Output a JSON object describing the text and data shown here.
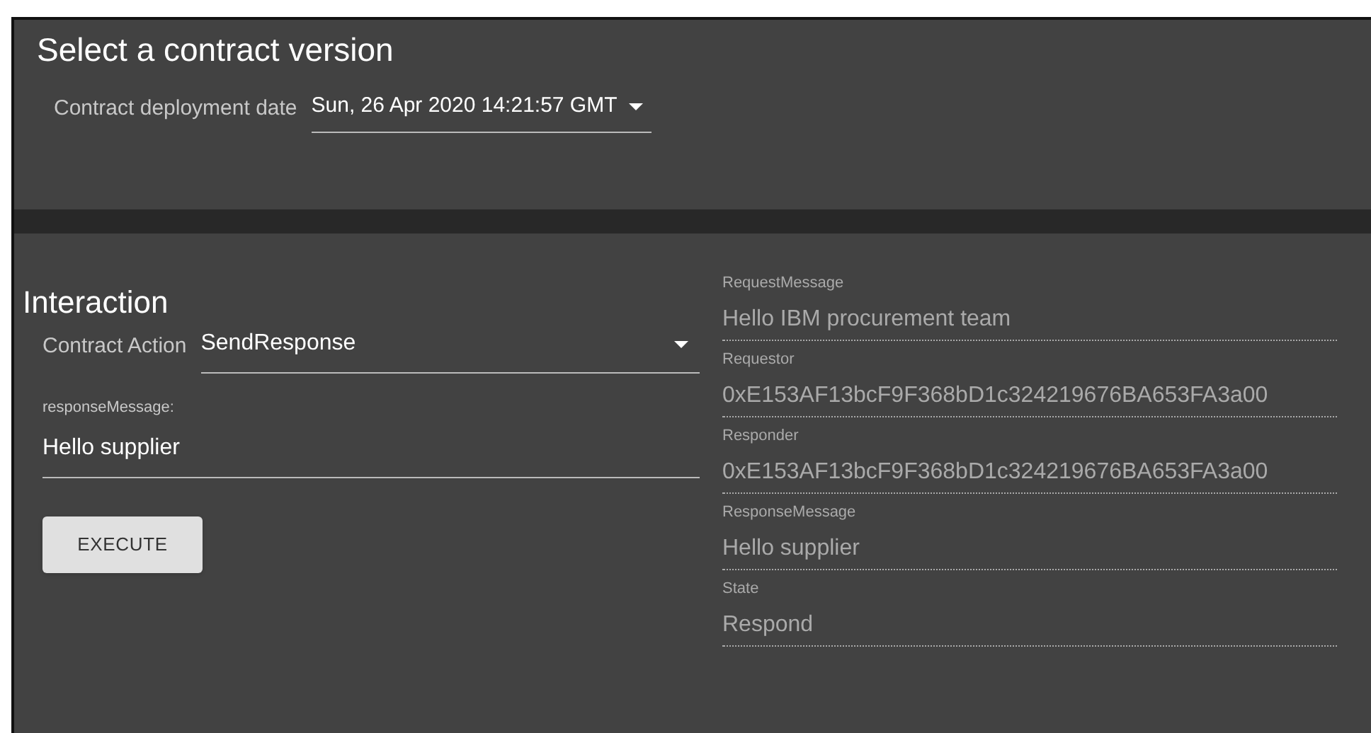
{
  "version_section": {
    "title": "Select a contract version",
    "label": "Contract deployment date",
    "value": "Sun, 26 Apr 2020 14:21:57 GMT"
  },
  "interaction": {
    "title": "Interaction",
    "action_label": "Contract Action",
    "action_value": "SendResponse",
    "input_label": "responseMessage:",
    "input_value": "Hello supplier",
    "button": "EXECUTE"
  },
  "properties": [
    {
      "label": "RequestMessage",
      "value": "Hello IBM procurement team"
    },
    {
      "label": "Requestor",
      "value": "0xE153AF13bcF9F368bD1c324219676BA653FA3a00"
    },
    {
      "label": "Responder",
      "value": "0xE153AF13bcF9F368bD1c324219676BA653FA3a00"
    },
    {
      "label": "ResponseMessage",
      "value": "Hello supplier"
    },
    {
      "label": "State",
      "value": "Respond"
    }
  ]
}
